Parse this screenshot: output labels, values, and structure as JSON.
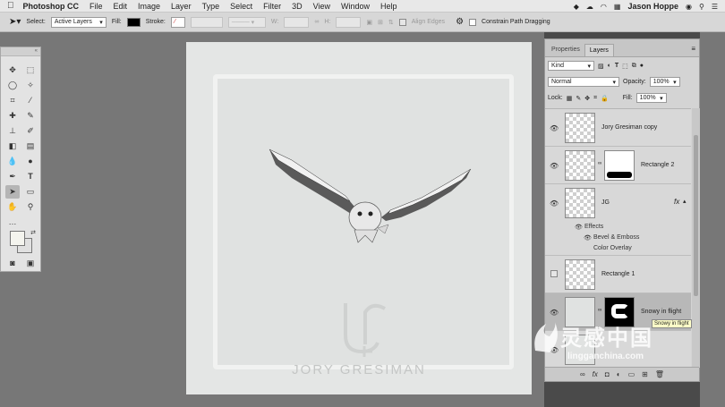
{
  "menubar": {
    "app_name": "Photoshop CC",
    "items": [
      "File",
      "Edit",
      "Image",
      "Layer",
      "Type",
      "Select",
      "Filter",
      "3D",
      "View",
      "Window",
      "Help"
    ],
    "user": "Jason Hoppe"
  },
  "options": {
    "select_label": "Select:",
    "select_value": "Active Layers",
    "fill_label": "Fill:",
    "stroke_label": "Stroke:",
    "w_label": "W:",
    "h_label": "H:",
    "align_edges": "Align Edges",
    "constrain": "Constrain Path Dragging"
  },
  "document": {
    "logo_text": "JORY GRESIMAN"
  },
  "layers_panel": {
    "tabs": [
      "Properties",
      "Layers"
    ],
    "kind": "Kind",
    "blend_mode": "Normal",
    "opacity_label": "Opacity:",
    "opacity_value": "100%",
    "lock_label": "Lock:",
    "fill_label": "Fill:",
    "fill_value": "100%",
    "layers": [
      {
        "name": "Jory Gresiman copy"
      },
      {
        "name": "Rectangle 2"
      },
      {
        "name": "JG",
        "fx": "fx"
      },
      {
        "name": "Rectangle 1"
      },
      {
        "name": "Snowy in flight"
      }
    ],
    "effects_label": "Effects",
    "effect1": "Bevel & Emboss",
    "effect2": "Color Overlay",
    "tooltip": "Snowy in flight"
  },
  "watermark": {
    "cn": "灵感中国",
    "url": "lingganchina.com"
  },
  "colors": {
    "accent": "#6b6b6b",
    "selected_layer": "#b8b8b8"
  }
}
